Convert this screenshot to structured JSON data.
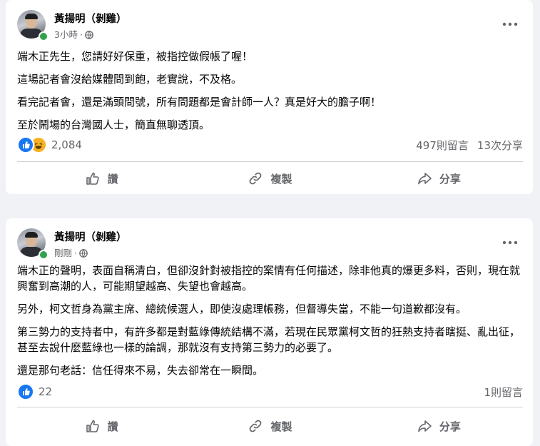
{
  "posts": [
    {
      "author": "黃揚明（剝雞）",
      "time": "3小時",
      "separator": "·",
      "paragraphs": [
        "端木正先生，您請好好保重，被指控做假帳了喔！",
        "這場記者會沒給媒體問到飽，老實說，不及格。",
        "看完記者會，還是滿頭問號，所有問題都是會計師一人？真是好大的膽子啊！",
        "至於鬧場的台灣國人士，簡直無聊透頂。"
      ],
      "reaction_count": "2,084",
      "reactions": [
        "like-icon",
        "haha-icon"
      ],
      "comments": "497則留言",
      "shares": "13次分享"
    },
    {
      "author": "黃揚明（剝雞）",
      "time": "剛剛",
      "separator": "·",
      "paragraphs": [
        "端木正的聲明，表面自稱清白，但卻沒針對被指控的案情有任何描述，除非他真的爆更多料，否則，現在就興奮到高潮的人，可能期望越高、失望也會越高。",
        "另外，柯文哲身為黨主席、總統候選人，即使沒處理帳務，但督導失當，不能一句道歉都沒有。",
        "第三勢力的支持者中，有許多都是對藍綠傳統結構不滿，若現在民眾黨柯文哲的狂熱支持者瞎挺、亂出征，甚至去說什麼藍綠也一樣的論調，那就沒有支持第三勢力的必要了。",
        "還是那句老話：信任得來不易，失去卻常在一瞬間。"
      ],
      "reaction_count": "22",
      "reactions": [
        "like-icon"
      ],
      "comments": "1則留言",
      "shares": ""
    }
  ],
  "actions": {
    "like_label": "讚",
    "copy_label": "複製",
    "share_label": "分享"
  },
  "icons": {
    "globe": "globe-icon",
    "more": "more-options-icon",
    "like": "thumbs-up-icon",
    "copy": "link-icon",
    "share": "share-arrow-icon"
  },
  "colors": {
    "background": "#f0f2f5",
    "card": "#ffffff",
    "secondary_text": "#65676b",
    "like_blue": "#1877f2",
    "haha_yellow": "#f7b125",
    "online_green": "#31a24c"
  }
}
